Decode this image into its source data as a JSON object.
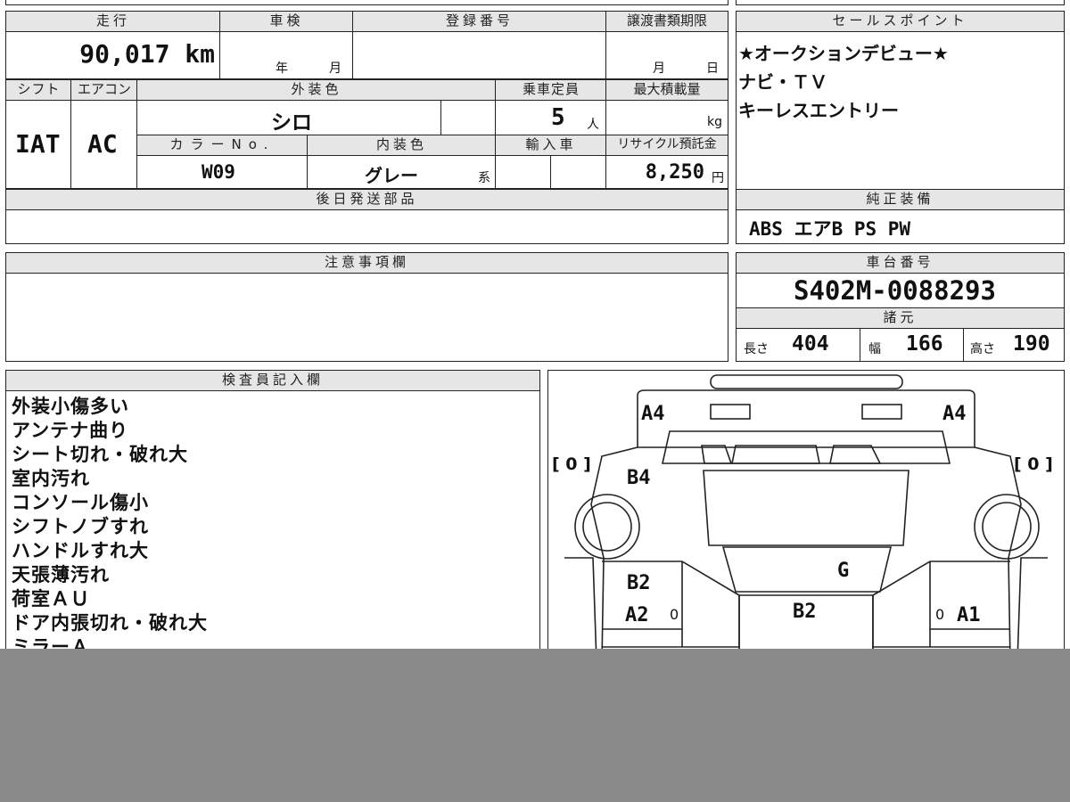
{
  "top_header": {
    "mileage_label": "走行",
    "inspection_label": "車検",
    "registration_label": "登録番号",
    "transfer_deadline_label": "譲渡書類期限",
    "sales_points_label": "セールスポイント"
  },
  "mileage": "90,017 km",
  "inspection_year_unit": "年",
  "inspection_month_unit": "月",
  "transfer_month_unit": "月",
  "transfer_day_unit": "日",
  "row2_headers": {
    "shift": "シフト",
    "aircon": "エアコン",
    "exterior_color": "外装色",
    "capacity": "乗車定員",
    "max_load": "最大積載量"
  },
  "shift": "IAT",
  "aircon": "AC",
  "exterior_color": "シロ",
  "capacity": "5",
  "capacity_unit": "人",
  "max_load_unit": "kg",
  "row3_headers": {
    "color_no": "カラーNo.",
    "interior_color": "内装色",
    "imported": "輸入車",
    "recycle_fee": "リサイクル預託金"
  },
  "color_no": "W09",
  "interior_color": "グレー",
  "interior_suffix": "系",
  "recycle_fee": "8,250",
  "recycle_unit": "円",
  "later_parts_label": "後日発送部品",
  "sales_points": [
    "★オークションデビュー★",
    "ナビ・ＴＶ",
    "キーレスエントリー"
  ],
  "genuine_equipment_label": "純正装備",
  "genuine_equipment": "ABS エアB PS PW",
  "notes_label": "注意事項欄",
  "chassis_label": "車台番号",
  "chassis_number": "S402M-0088293",
  "specs_label": "諸元",
  "length_label": "長さ",
  "length": "404",
  "width_label": "幅",
  "width": "166",
  "height_label": "高さ",
  "height": "190",
  "inspector_label": "検査員記入欄",
  "inspector_remarks": [
    "外装小傷多い",
    "アンテナ曲り",
    "シート切れ・破れ大",
    "室内汚れ",
    "コンソール傷小",
    "シフトノブすれ",
    "ハンドルすれ大",
    "天張薄汚れ",
    "荷室ＡＵ",
    "ドア内張切れ・破れ大",
    "ミラーＡ"
  ],
  "diagram": {
    "a4_left": "A4",
    "a4_right": "A4",
    "tire_left": "[ 0 ]",
    "tire_right": "[ 0 ]",
    "b4": "B4",
    "b2_left": "B2",
    "a2": "A2",
    "zero_left": "0",
    "g": "G",
    "b2_center": "B2",
    "zero_right": "0",
    "a1": "A1"
  }
}
